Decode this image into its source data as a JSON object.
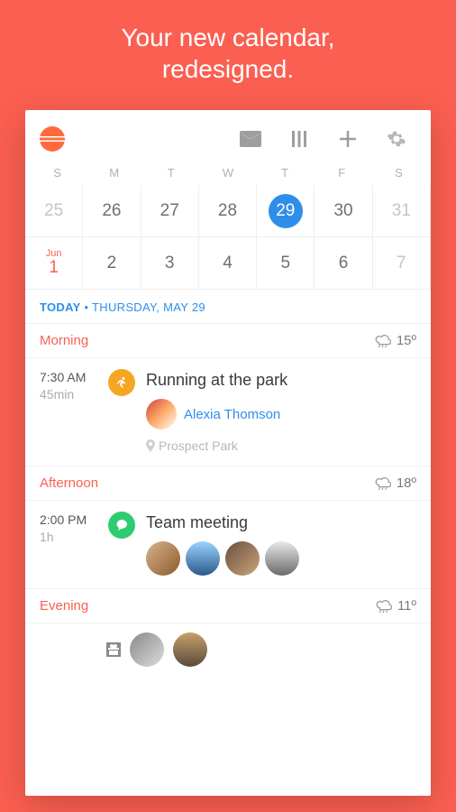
{
  "hero": {
    "line1": "Your new calendar,",
    "line2": "redesigned."
  },
  "weekdays": [
    "S",
    "M",
    "T",
    "W",
    "T",
    "F",
    "S"
  ],
  "weeks": [
    {
      "days": [
        {
          "n": "25",
          "dim": true
        },
        {
          "n": "26"
        },
        {
          "n": "27"
        },
        {
          "n": "28"
        },
        {
          "n": "29",
          "today": true
        },
        {
          "n": "30"
        },
        {
          "n": "31",
          "dim": true
        }
      ]
    },
    {
      "monthLabel": "Jun",
      "days": [
        {
          "n": "1",
          "monthStart": true
        },
        {
          "n": "2"
        },
        {
          "n": "3"
        },
        {
          "n": "4"
        },
        {
          "n": "5"
        },
        {
          "n": "6"
        },
        {
          "n": "7",
          "dim": true
        }
      ]
    }
  ],
  "dateHeader": {
    "today": "TODAY",
    "sep": " • ",
    "date": "THURSDAY, MAY 29"
  },
  "sections": {
    "morning": {
      "label": "Morning",
      "temp": "15º"
    },
    "afternoon": {
      "label": "Afternoon",
      "temp": "18º"
    },
    "evening": {
      "label": "Evening",
      "temp": "11º"
    }
  },
  "events": {
    "morning": {
      "time": "7:30 AM",
      "duration": "45min",
      "title": "Running at the park",
      "attendeeName": "Alexia Thomson",
      "location": "Prospect Park"
    },
    "afternoon": {
      "time": "2:00 PM",
      "duration": "1h",
      "title": "Team meeting"
    }
  }
}
